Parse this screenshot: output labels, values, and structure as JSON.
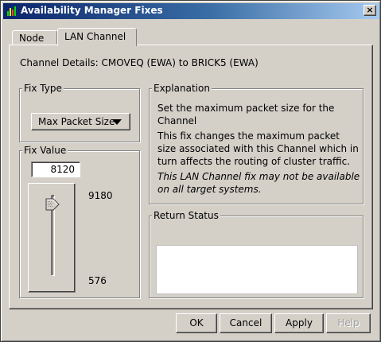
{
  "window": {
    "title": "Availability Manager Fixes",
    "close_label": "×"
  },
  "tabs": [
    {
      "label": "Node",
      "selected": false
    },
    {
      "label": "LAN Channel",
      "selected": true
    }
  ],
  "channel_details": "Channel Details: CMOVEQ (EWA) to BRICK5 (EWA)",
  "fix_type": {
    "title": "Fix Type",
    "selected": "Max Packet Size"
  },
  "fix_value": {
    "title": "Fix Value",
    "value": "8120",
    "max_label": "9180",
    "min_label": "576",
    "slider_fraction": 0.88
  },
  "explanation": {
    "title": "Explanation",
    "line1": "Set the maximum packet size for the Channel",
    "line2": "This fix changes the maximum packet size associated with this Channel which in turn affects the routing of cluster traffic.",
    "note": "This LAN Channel fix may not be available on all target systems."
  },
  "return_status": {
    "title": "Return Status",
    "text": ""
  },
  "buttons": {
    "ok": "OK",
    "cancel": "Cancel",
    "apply": "Apply",
    "help": "Help"
  },
  "colors": {
    "titlebar_start": "#0a246a",
    "titlebar_end": "#a6caf0",
    "face": "#d4d0c8"
  },
  "icons": {
    "app": "bar-chart-icon",
    "close": "close-icon",
    "dropdown": "chevron-down-icon"
  }
}
